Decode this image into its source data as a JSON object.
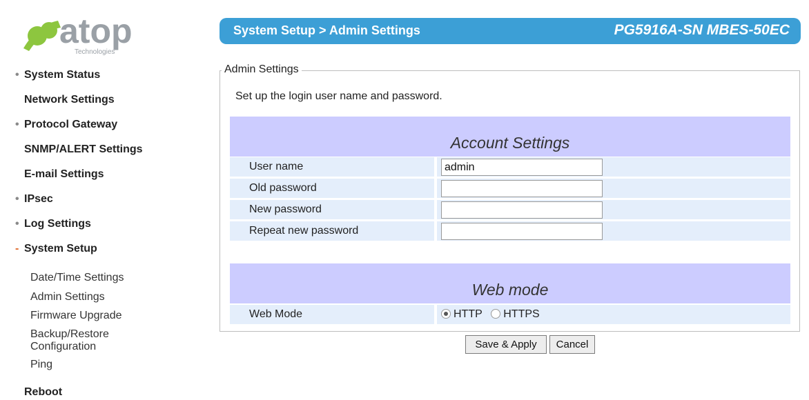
{
  "brand": {
    "logo_name": "atop",
    "logo_tagline": "Technologies",
    "accent_color": "#8dc63f",
    "wordmark_color": "#9aa0a6"
  },
  "header": {
    "breadcrumb": "System Setup > Admin Settings",
    "model": "PG5916A-SN MBES-50EC",
    "background": "#3c9fd6"
  },
  "sidebar": {
    "items": [
      {
        "label": "System Status",
        "bullet": "•"
      },
      {
        "label": "Network Settings",
        "bullet": ""
      },
      {
        "label": "Protocol Gateway",
        "bullet": "•"
      },
      {
        "label": "SNMP/ALERT Settings",
        "bullet": ""
      },
      {
        "label": "E-mail Settings",
        "bullet": ""
      },
      {
        "label": "IPsec",
        "bullet": "•"
      },
      {
        "label": "Log Settings",
        "bullet": "•"
      },
      {
        "label": "System Setup",
        "bullet": "-"
      },
      {
        "label": "Reboot",
        "bullet": ""
      }
    ],
    "sub_items": [
      {
        "label": "Date/Time Settings"
      },
      {
        "label": "Admin Settings"
      },
      {
        "label": "Firmware Upgrade"
      },
      {
        "label": "Backup/Restore",
        "label2": "Configuration"
      },
      {
        "label": "Ping"
      }
    ]
  },
  "main": {
    "legend": "Admin Settings",
    "intro": "Set up the login user name and password.",
    "account_section": {
      "title": "Account Settings",
      "fields": [
        {
          "label": "User name",
          "value": "admin"
        },
        {
          "label": "Old password",
          "value": ""
        },
        {
          "label": "New password",
          "value": ""
        },
        {
          "label": "Repeat new password",
          "value": ""
        }
      ]
    },
    "web_section": {
      "title": "Web mode",
      "label": "Web Mode",
      "options": [
        "HTTP",
        "HTTPS"
      ],
      "selected": "HTTP"
    },
    "section_color": "#ccccff",
    "row_color": "#e4eefb"
  },
  "buttons": {
    "save": "Save & Apply",
    "cancel": "Cancel"
  }
}
